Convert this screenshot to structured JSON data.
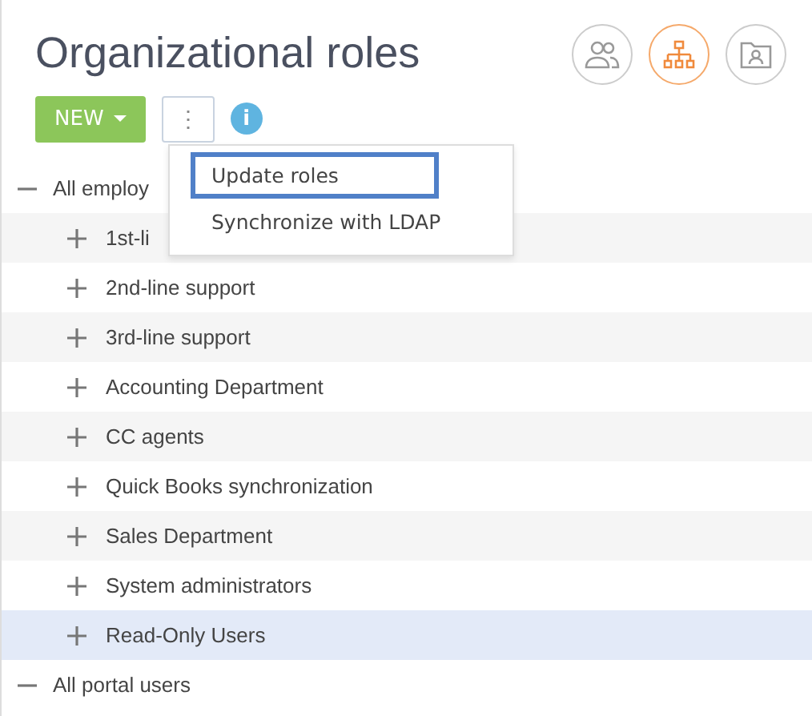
{
  "title": "Organizational roles",
  "view_buttons": [
    {
      "kind": "users",
      "selected": false
    },
    {
      "kind": "org",
      "selected": true
    },
    {
      "kind": "folder",
      "selected": false
    }
  ],
  "toolbar": {
    "new_button": "NEW",
    "more_button": "⋮",
    "info": "i"
  },
  "menu": [
    {
      "label": "Update roles",
      "selected": true
    },
    {
      "label": "Synchronize with LDAP",
      "selected": false
    }
  ],
  "tree": [
    {
      "label": "All employ",
      "expanded": true,
      "selected": false,
      "children": [
        {
          "label": "1st-li",
          "expanded": false,
          "selected": false
        },
        {
          "label": "2nd-line support",
          "expanded": false,
          "selected": false
        },
        {
          "label": "3rd-line support",
          "expanded": false,
          "selected": false
        },
        {
          "label": "Accounting Department",
          "expanded": false,
          "selected": false
        },
        {
          "label": "CC agents",
          "expanded": false,
          "selected": false
        },
        {
          "label": "Quick Books synchronization",
          "expanded": false,
          "selected": false
        },
        {
          "label": "Sales Department",
          "expanded": false,
          "selected": false
        },
        {
          "label": "System administrators",
          "expanded": false,
          "selected": false
        },
        {
          "label": "Read-Only Users",
          "expanded": false,
          "selected": true
        }
      ]
    },
    {
      "label": "All portal users",
      "expanded": true,
      "selected": false
    }
  ]
}
